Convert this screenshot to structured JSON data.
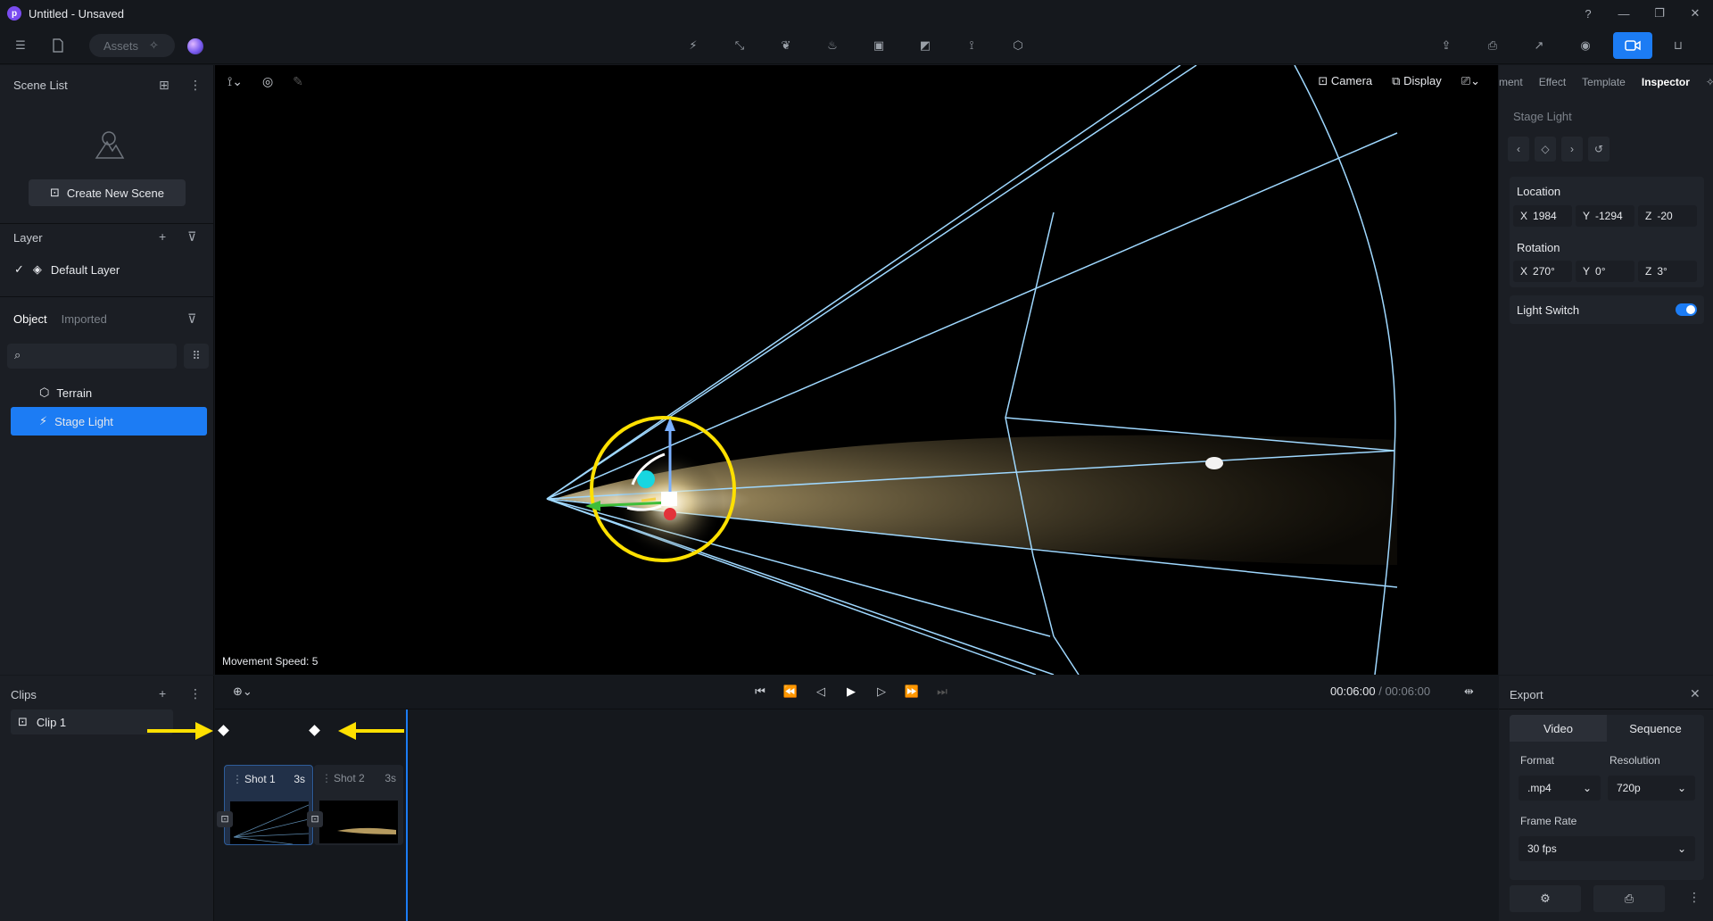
{
  "window": {
    "title": "Untitled - Unsaved",
    "logo_letter": "p",
    "controls": [
      "?",
      "—",
      "❐",
      "✕"
    ]
  },
  "toolbar": {
    "assets_label": "Assets"
  },
  "scene": {
    "header": "Scene List",
    "create_label": "Create New Scene"
  },
  "layer": {
    "header": "Layer",
    "default_layer": "Default Layer"
  },
  "objects": {
    "tab_object": "Object",
    "tab_imported": "Imported",
    "items": [
      "Terrain",
      "Stage Light"
    ]
  },
  "viewport": {
    "camera_label": "Camera",
    "display_label": "Display",
    "speed_text": "Movement Speed: 5"
  },
  "inspector": {
    "tabs": [
      "ment",
      "Effect",
      "Template",
      "Inspector"
    ],
    "selected_name": "Stage Light",
    "location_label": "Location",
    "location": {
      "x": "1984",
      "y": "-1294",
      "z": "-20"
    },
    "rotation_label": "Rotation",
    "rotation": {
      "x": "270°",
      "y": "0°",
      "z": "3°"
    },
    "light_switch_label": "Light Switch",
    "light_switch_on": true
  },
  "clips": {
    "header": "Clips",
    "items": [
      "Clip 1"
    ]
  },
  "timeline": {
    "current_time": "00:06:00",
    "separator": " / ",
    "total_time": "00:06:00",
    "shots": [
      {
        "label": "Shot 1",
        "duration": "3s"
      },
      {
        "label": "Shot 2",
        "duration": "3s"
      }
    ]
  },
  "export": {
    "header": "Export",
    "tabs": [
      "Video",
      "Sequence"
    ],
    "format_label": "Format",
    "format_value": ".mp4",
    "resolution_label": "Resolution",
    "resolution_value": "720p",
    "framerate_label": "Frame Rate",
    "framerate_value": "30 fps"
  },
  "colors": {
    "accent": "#1c7cf4",
    "highlight": "#ffe000",
    "wire": "#9fd8ff"
  }
}
